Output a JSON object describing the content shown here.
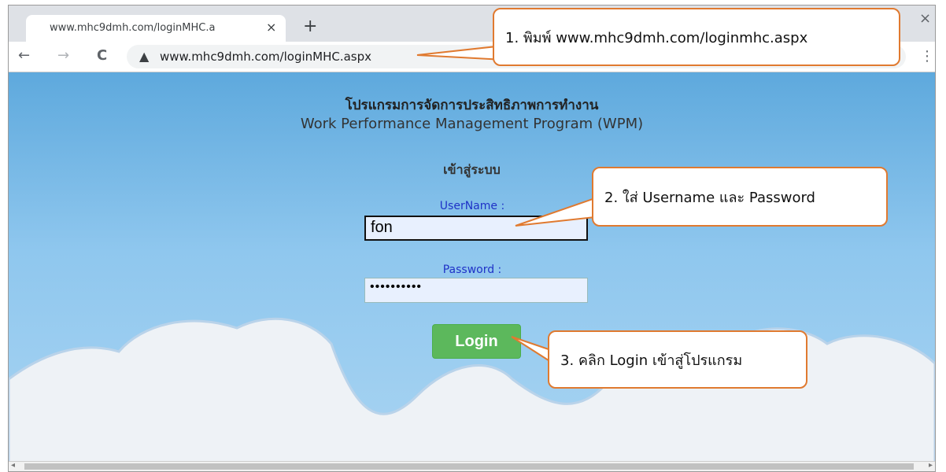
{
  "browser": {
    "tab_title": "www.mhc9dmh.com/loginMHC.a",
    "tab_close": "×",
    "new_tab": "+",
    "window_close": "×",
    "url": "www.mhc9dmh.com/loginMHC.aspx",
    "back": "←",
    "forward": "→",
    "reload": "C",
    "warning": "▲",
    "menu": "⋮"
  },
  "page": {
    "title_thai": "โปรแกรมการจัดการประสิทธิภาพการทำงาน",
    "title_en": "Work Performance Management Program (WPM)",
    "login_heading": "เข้าสู่ระบบ",
    "username_label": "UserName :",
    "username_value": "fon",
    "password_label": "Password :",
    "password_value": "••••••••••",
    "login_button": "Login"
  },
  "callouts": {
    "step1": "1. พิมพ์ www.mhc9dmh.com/loginmhc.aspx",
    "step2": "2. ใส่ Username และ Password",
    "step3": "3. คลิก Login เข้าสู่โปรแกรม"
  },
  "scrollbar": {
    "left": "◂",
    "right": "▸"
  },
  "colors": {
    "accent": "#e07a30",
    "login_green": "#5cb85c",
    "label_blue": "#1f32c7"
  }
}
